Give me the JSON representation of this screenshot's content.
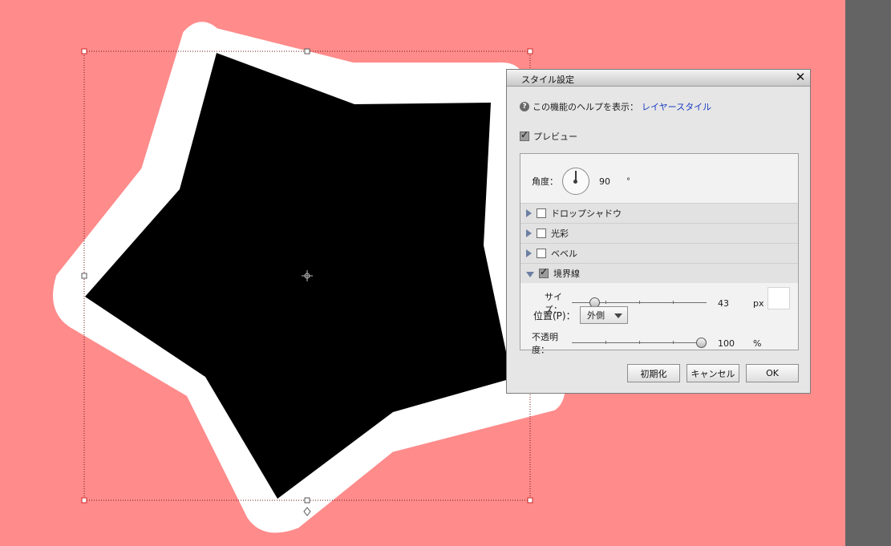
{
  "dialog": {
    "title": "スタイル設定",
    "close_glyph": "✕",
    "help_icon_glyph": "?",
    "help_text": "この機能のヘルプを表示：",
    "help_link": "レイヤースタイル",
    "preview_label": "プレビュー",
    "preview_checked": true
  },
  "angle": {
    "label": "角度：",
    "value": "90",
    "unit": "°"
  },
  "sections": [
    {
      "label": "ドロップシャドウ",
      "checked": false,
      "expanded": false
    },
    {
      "label": "光彩",
      "checked": false,
      "expanded": false
    },
    {
      "label": "ベベル",
      "checked": false,
      "expanded": false
    },
    {
      "label": "境界線",
      "checked": true,
      "expanded": true
    }
  ],
  "stroke": {
    "size_label": "サイズ：",
    "size_value": "43",
    "size_unit": "px",
    "size_fraction": 0.14,
    "position_label": "位置(P)：",
    "position_value": "外側",
    "opacity_label": "不透明度：",
    "opacity_value": "100",
    "opacity_unit": "%",
    "opacity_fraction": 1.0,
    "color": "#ffffff"
  },
  "buttons": {
    "reset": "初期化",
    "cancel": "キャンセル",
    "ok": "OK"
  },
  "colors": {
    "canvas_bg": "#ff8b8b",
    "right_panel": "#646464",
    "star_fill": "#000000",
    "stroke_color": "#ffffff",
    "selection_handle": "#cc2a2a",
    "link_color": "#1b3dc2"
  }
}
